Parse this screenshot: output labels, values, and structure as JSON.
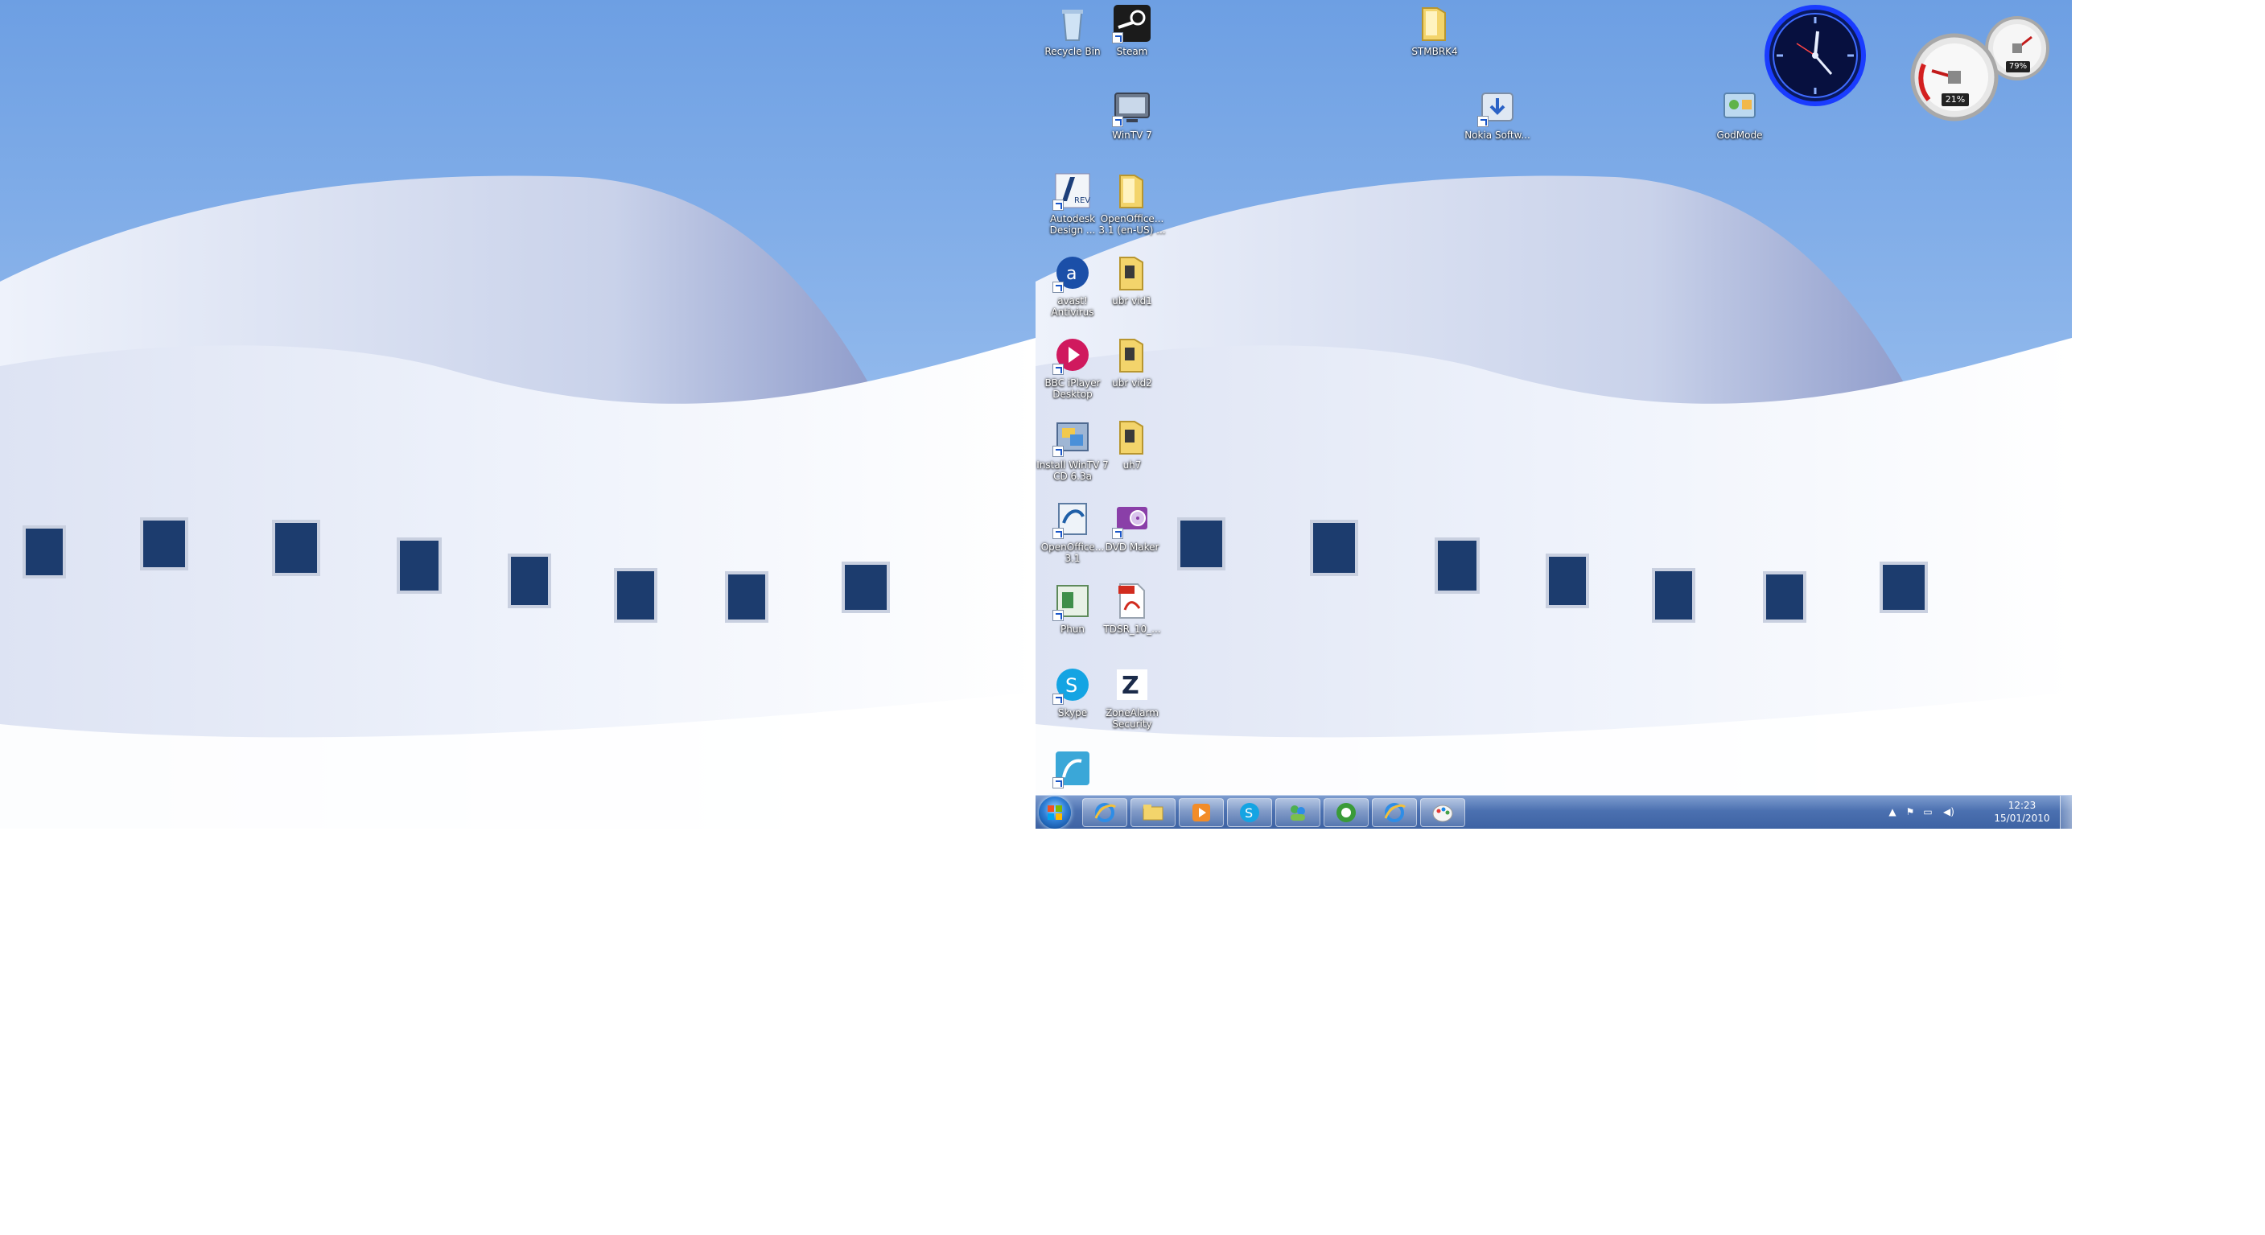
{
  "desktop_icons": [
    {
      "id": "recycle-bin",
      "label": "Recycle Bin"
    },
    {
      "id": "steam",
      "label": "Steam"
    },
    {
      "id": "stmbrk",
      "label": "STMBRK4"
    },
    {
      "id": "wintv7",
      "label": "WinTV 7"
    },
    {
      "id": "nokia-software",
      "label": "Nokia Softw..."
    },
    {
      "id": "godmode",
      "label": "GodMode"
    },
    {
      "id": "autodesk-design",
      "label": "Autodesk Design ..."
    },
    {
      "id": "openoffice-installer",
      "label": "OpenOffice... 3.1 (en-US) ..."
    },
    {
      "id": "avast-antivirus",
      "label": "avast! Antivirus"
    },
    {
      "id": "ubr-vid",
      "label": "ubr vid1"
    },
    {
      "id": "bbc-iplayer",
      "label": "BBC iPlayer Desktop"
    },
    {
      "id": "ubr-vid2",
      "label": "ubr vid2"
    },
    {
      "id": "install-wintv",
      "label": "Install WinTV 7 CD 6.3a"
    },
    {
      "id": "uh7",
      "label": "uh7"
    },
    {
      "id": "openoffice",
      "label": "OpenOffice... 3.1"
    },
    {
      "id": "dvd-maker",
      "label": "DVD Maker"
    },
    {
      "id": "phun",
      "label": "Phun"
    },
    {
      "id": "pdf-file",
      "label": "TDSR_10_..."
    },
    {
      "id": "skype",
      "label": "Skype"
    },
    {
      "id": "zonealarm",
      "label": "ZoneAlarm Security"
    },
    {
      "id": "extra-shortcut",
      "label": ""
    }
  ],
  "taskbar": {
    "pinned": [
      {
        "id": "ie",
        "icon": "ie-icon"
      },
      {
        "id": "explorer",
        "icon": "folder-icon"
      },
      {
        "id": "media-player",
        "icon": "media-player-icon"
      },
      {
        "id": "skype",
        "icon": "skype-icon"
      },
      {
        "id": "messenger",
        "icon": "messenger-icon"
      },
      {
        "id": "media-center",
        "icon": "media-center-icon"
      },
      {
        "id": "ie2",
        "icon": "ie-icon"
      },
      {
        "id": "paint",
        "icon": "paint-icon"
      }
    ],
    "tray": {
      "show_hidden": "▲",
      "flag": "⚑",
      "network": "▭",
      "volume": "◀)"
    },
    "clock": {
      "time": "12:23",
      "date": "15/01/2010"
    }
  },
  "gadgets": {
    "cpu_meter": {
      "cpu_percent": "21%",
      "memory_percent": "79%"
    }
  },
  "colors": {
    "sky_top": "#6a9fe4",
    "sky_bottom": "#b4d2f6",
    "building": "#e6ecf8",
    "taskbar": "#4b70b0",
    "clock_ring": "#1a3cff"
  }
}
